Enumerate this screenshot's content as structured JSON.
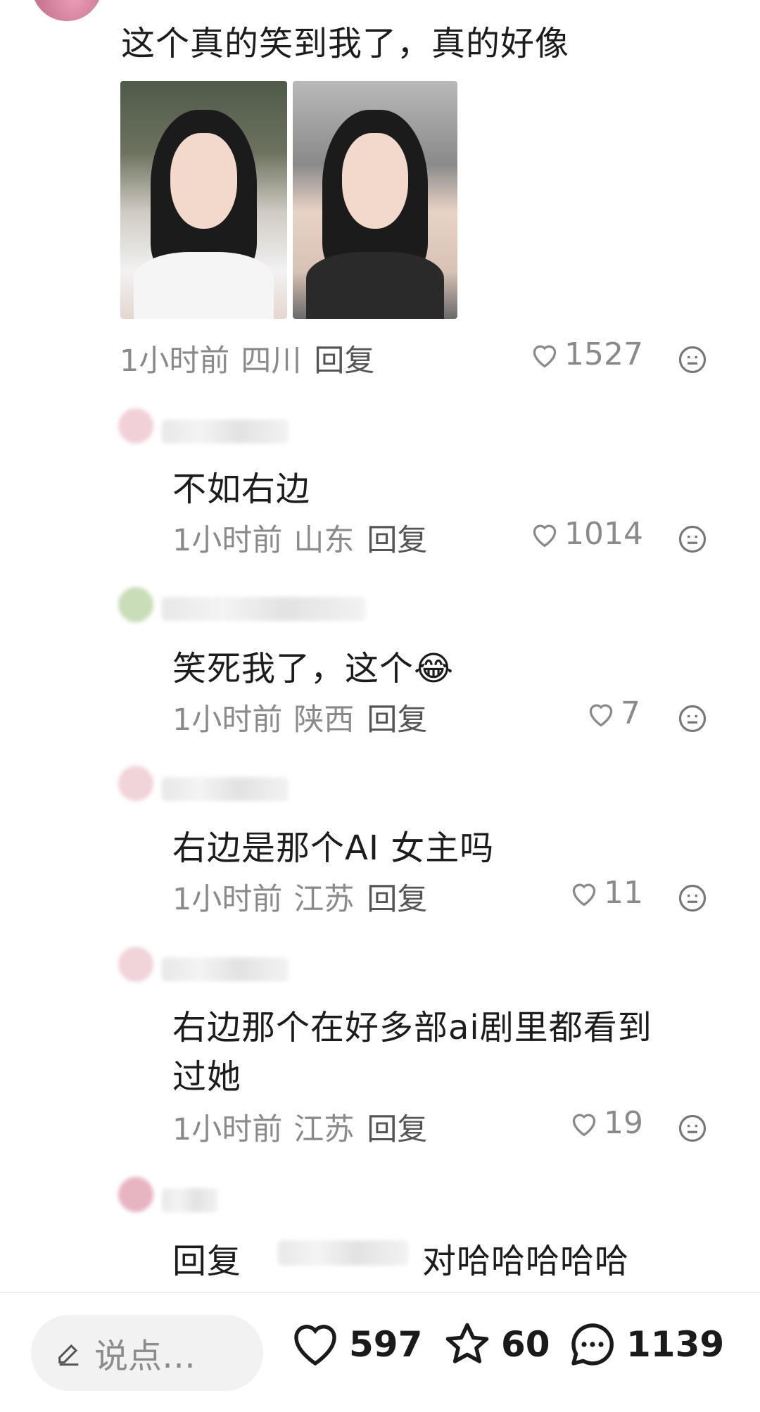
{
  "top_comment": {
    "text": "这个真的笑到我了，真的好像",
    "time": "1小时前",
    "location": "四川",
    "reply_label": "回复",
    "likes": "1527"
  },
  "replies": [
    {
      "text": "不如右边",
      "time": "1小时前",
      "location": "山东",
      "reply_label": "回复",
      "likes": "1014"
    },
    {
      "text": "笑死我了，这个",
      "emoji": "😂",
      "time": "1小时前",
      "location": "陕西",
      "reply_label": "回复",
      "likes": "7"
    },
    {
      "text": "右边是那个AI 女主吗",
      "time": "1小时前",
      "location": "江苏",
      "reply_label": "回复",
      "likes": "11"
    },
    {
      "text_line1": "右边那个在好多部ai剧里都看到",
      "text_line2": "过她",
      "time": "1小时前",
      "location": "江苏",
      "reply_label": "回复",
      "likes": "19"
    },
    {
      "reply_prefix": "回复",
      "text": "对哈哈哈哈哈"
    }
  ],
  "bottom_bar": {
    "input_placeholder": "说点…",
    "likes": "597",
    "favorites": "60",
    "comments": "1139"
  },
  "icons": {
    "like": "heart-outline-icon",
    "emoji": "emoji-face-icon",
    "edit": "pencil-icon",
    "favorite": "star-icon",
    "comment": "chat-bubble-icon"
  }
}
